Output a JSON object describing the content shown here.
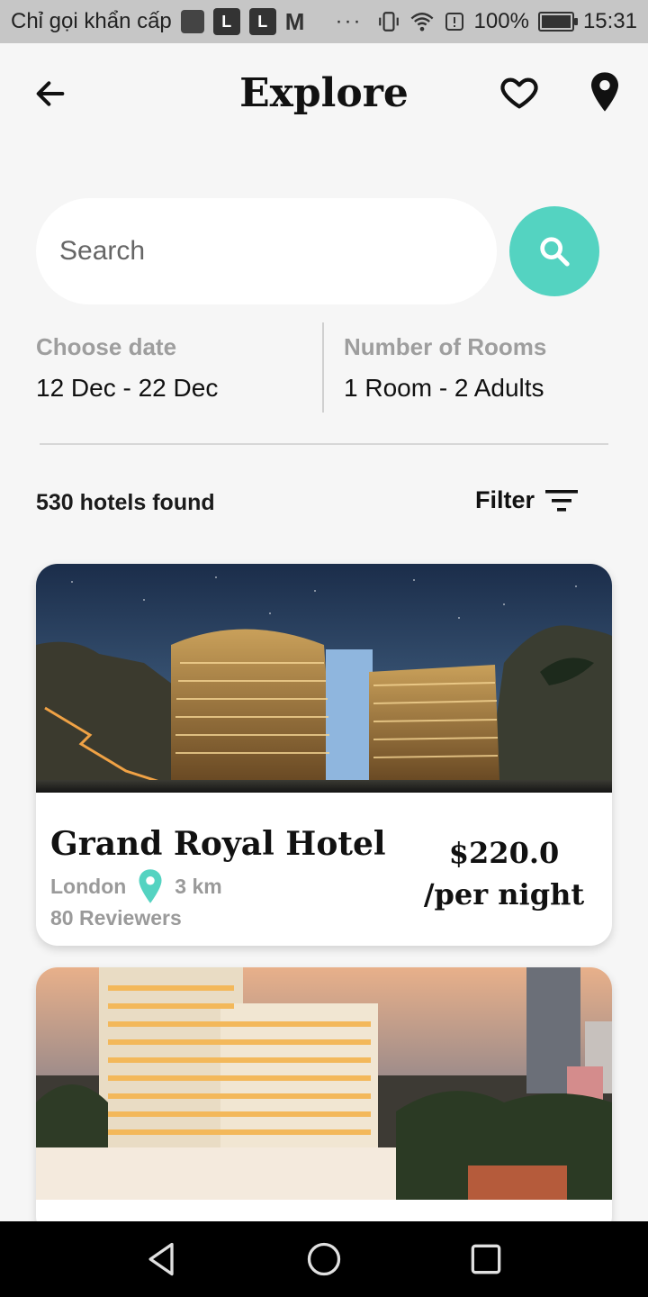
{
  "status": {
    "carrier": "Chỉ gọi khẩn cấp",
    "app1": "L",
    "app2": "L",
    "mail": "M",
    "dots": "···",
    "battery": "100%",
    "time": "15:31",
    "battery_level": 1.0
  },
  "header": {
    "title": "Explore",
    "back_icon": "arrow-left-icon",
    "favorite_icon": "heart-outline-icon",
    "location_icon": "map-pin-icon"
  },
  "search": {
    "placeholder": "Search",
    "value": "",
    "icon": "search-icon",
    "accent": "#54d3c1"
  },
  "filters": {
    "date_label": "Choose date",
    "date_value": "12 Dec - 22 Dec",
    "rooms_label": "Number of Rooms",
    "rooms_value": "1 Room - 2 Adults"
  },
  "results": {
    "count": "530 hotels found",
    "filter_label": "Filter",
    "filter_icon": "sort-lines-icon"
  },
  "hotels": [
    {
      "name": "Grand Royal Hotel",
      "city": "London",
      "distance": "3 km",
      "reviews": "80 Reviewers",
      "price": "$220.0",
      "price_unit": "/per night"
    }
  ],
  "navbar": {
    "back": "triangle-back-icon",
    "home": "circle-home-icon",
    "recents": "square-recents-icon"
  }
}
